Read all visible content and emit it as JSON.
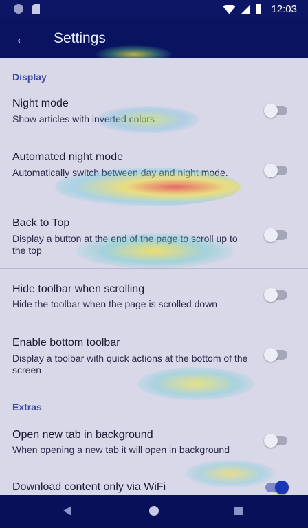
{
  "status_bar": {
    "time": "12:03",
    "icons": [
      "notification-dot-icon",
      "sd-card-icon",
      "wifi-icon",
      "cell-signal-icon",
      "battery-icon"
    ]
  },
  "app_bar": {
    "title": "Settings",
    "back_icon": "back-arrow-icon"
  },
  "sections": [
    {
      "header": "Display",
      "items": [
        {
          "title": "Night mode",
          "summary": "Show articles with inverted colors",
          "enabled": false
        },
        {
          "title": "Automated night mode",
          "summary": "Automatically switch between day and night mode.",
          "enabled": false
        },
        {
          "title": "Back to Top",
          "summary": "Display a button at the end of the page to scroll up to the top",
          "enabled": false
        },
        {
          "title": "Hide toolbar when scrolling",
          "summary": "Hide the toolbar when the page is scrolled down",
          "enabled": false
        },
        {
          "title": "Enable bottom toolbar",
          "summary": "Display a toolbar with quick actions at the bottom of the screen",
          "enabled": false
        }
      ]
    },
    {
      "header": "Extras",
      "items": [
        {
          "title": "Open new tab in background",
          "summary": "When opening a new tab it will open in background",
          "enabled": false
        },
        {
          "title": "Download content only via WiFi",
          "summary": "",
          "enabled": true
        }
      ]
    }
  ],
  "nav_bar": {
    "icons": [
      "nav-back-icon",
      "nav-home-icon",
      "nav-recents-icon"
    ]
  },
  "colors": {
    "app_bar": "#0a1360",
    "accent": "#1a36b8",
    "section_header": "#3b4aa8"
  }
}
